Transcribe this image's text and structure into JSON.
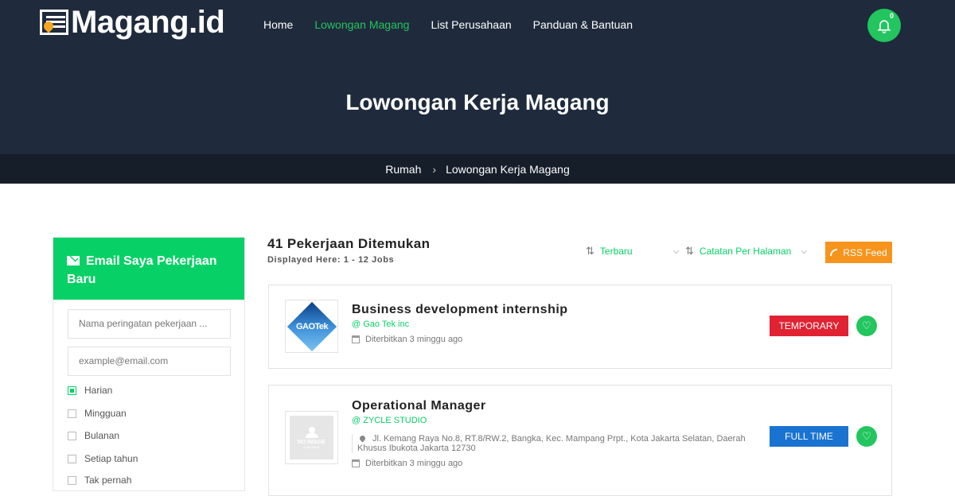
{
  "brand": {
    "name": "Magang.id"
  },
  "nav": {
    "items": [
      {
        "label": "Home"
      },
      {
        "label": "Lowongan Magang"
      },
      {
        "label": "List Perusahaan"
      },
      {
        "label": "Panduan & Bantuan"
      }
    ],
    "active": "Lowongan Magang",
    "notification_count": "0"
  },
  "hero": {
    "title": "Lowongan Kerja Magang"
  },
  "breadcrumb": {
    "home": "Rumah",
    "current": "Lowongan Kerja Magang"
  },
  "sidebar": {
    "title": "Email Saya Pekerjaan Baru",
    "alert_name_placeholder": "Nama peringatan pekerjaan ...",
    "email_placeholder": "example@email.com",
    "frequency_options": [
      {
        "label": "Harian",
        "checked": true
      },
      {
        "label": "Mingguan",
        "checked": false
      },
      {
        "label": "Bulanan",
        "checked": false
      },
      {
        "label": "Setiap tahun",
        "checked": false
      },
      {
        "label": "Tak pernah",
        "checked": false
      }
    ]
  },
  "results": {
    "found": "41 Pekerjaan Ditemukan",
    "displayed": "Displayed Here: 1 - 12 Jobs",
    "sort_label": "Terbaru",
    "per_page_label": "Catatan Per Halaman",
    "rss_label": "RSS Feed"
  },
  "jobs": [
    {
      "title": "Business development internship",
      "company": "@ Gao Tek inc",
      "logo_text": "GAOTek",
      "posted": "Diterbitkan 3 minggu ago",
      "type": "TEMPORARY"
    },
    {
      "title": "Operational Manager",
      "company": "@ ZYCLE STUDIO",
      "logo_text": "NO IMAGE",
      "logo_subtext": "AVAILABLE",
      "address": "Jl. Kemang Raya No.8, RT.8/RW.2, Bangka, Kec. Mampang Prpt., Kota Jakarta Selatan, Daerah Khusus Ibukota Jakarta 12730",
      "posted": "Diterbitkan 3 minggu ago",
      "type": "FULL TIME"
    }
  ],
  "colors": {
    "header_bg": "#1f2b3c",
    "accent": "#07d166",
    "temporary": "#e12233",
    "full_time": "#1a73d1",
    "rss": "#f7941d"
  }
}
